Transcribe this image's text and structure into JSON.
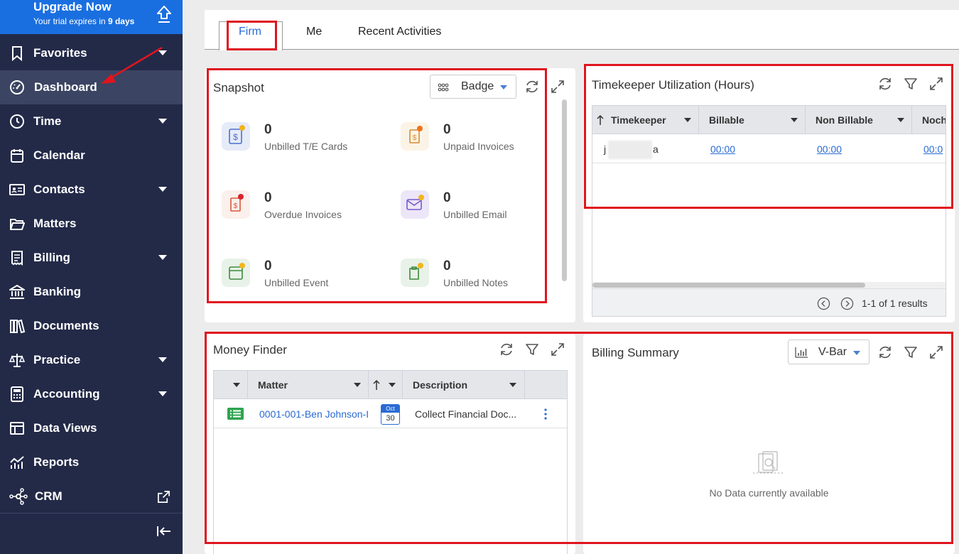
{
  "sidebar": {
    "upgrade_title": "Upgrade Now",
    "trial_prefix": "Your trial expires in ",
    "trial_days": "9 days",
    "items": [
      {
        "label": "Favorites",
        "icon": "bookmark-icon",
        "caret": true
      },
      {
        "label": "Dashboard",
        "icon": "dashboard-gauge-icon",
        "caret": false,
        "active": true
      },
      {
        "label": "Time",
        "icon": "clock-icon",
        "caret": true
      },
      {
        "label": "Calendar",
        "icon": "calendar-icon",
        "caret": false
      },
      {
        "label": "Contacts",
        "icon": "contact-card-icon",
        "caret": true
      },
      {
        "label": "Matters",
        "icon": "folder-open-icon",
        "caret": false
      },
      {
        "label": "Billing",
        "icon": "receipt-icon",
        "caret": true
      },
      {
        "label": "Banking",
        "icon": "bank-icon",
        "caret": false
      },
      {
        "label": "Documents",
        "icon": "library-icon",
        "caret": false
      },
      {
        "label": "Practice",
        "icon": "scales-icon",
        "caret": true
      },
      {
        "label": "Accounting",
        "icon": "calculator-icon",
        "caret": true
      },
      {
        "label": "Data Views",
        "icon": "table-layout-icon",
        "caret": false
      },
      {
        "label": "Reports",
        "icon": "reports-chart-icon",
        "caret": false
      },
      {
        "label": "CRM",
        "icon": "network-icon",
        "caret": false,
        "external": true
      }
    ]
  },
  "tabs": [
    "Firm",
    "Me",
    "Recent Activities"
  ],
  "snapshot": {
    "title": "Snapshot",
    "view_select": "Badge",
    "items": [
      {
        "value": "0",
        "label": "Unbilled T/E Cards"
      },
      {
        "value": "0",
        "label": "Unpaid Invoices"
      },
      {
        "value": "0",
        "label": "Overdue Invoices"
      },
      {
        "value": "0",
        "label": "Unbilled Email"
      },
      {
        "value": "0",
        "label": "Unbilled Event"
      },
      {
        "value": "0",
        "label": "Unbilled Notes"
      }
    ]
  },
  "utilization": {
    "title": "Timekeeper Utilization (Hours)",
    "columns": [
      "Timekeeper",
      "Billable",
      "Non Billable",
      "Noch"
    ],
    "row": {
      "name_start": "j",
      "name_end": "a",
      "billable": "00:00",
      "non_billable": "00:00",
      "nocharge": "00:0"
    },
    "pager": "1-1 of 1 results"
  },
  "money_finder": {
    "title": "Money Finder",
    "columns": [
      "Matter",
      "Description"
    ],
    "row": {
      "matter": "0001-001-Ben Johnson-I",
      "month": "Oct",
      "day": "30",
      "description": "Collect Financial Doc..."
    }
  },
  "billing_summary": {
    "title": "Billing Summary",
    "view_select": "V-Bar",
    "empty": "No Data currently available"
  },
  "colors": {
    "sidebar": "#232a48",
    "upgrade": "#1a6fe0",
    "highlight": "#e0141e",
    "link": "#2a6bd4"
  }
}
